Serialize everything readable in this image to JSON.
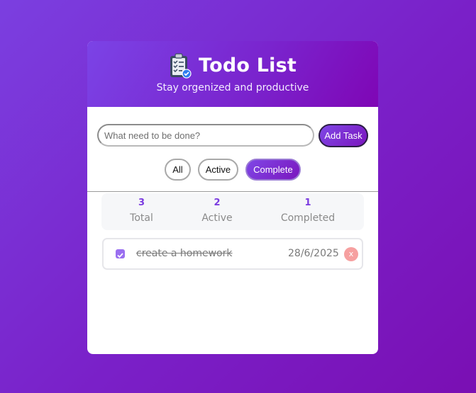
{
  "header": {
    "icon": "clipboard-checklist-icon",
    "title": "Todo List",
    "subtitle": "Stay orgenized and productive"
  },
  "input": {
    "placeholder": "What need to be done?",
    "value": "",
    "add_label": "Add Task"
  },
  "filters": [
    {
      "label": "All",
      "active": false
    },
    {
      "label": "Active",
      "active": false
    },
    {
      "label": "Complete",
      "active": true
    }
  ],
  "stats": [
    {
      "value": "3",
      "label": "Total"
    },
    {
      "value": "2",
      "label": "Active"
    },
    {
      "value": "1",
      "label": "Completed"
    }
  ],
  "tasks": [
    {
      "text": "create a homework",
      "date": "28/6/2025",
      "completed": true,
      "delete_label": "x"
    }
  ],
  "colors": {
    "accent": "#7b3fe0",
    "delete": "#f6a0a0"
  }
}
